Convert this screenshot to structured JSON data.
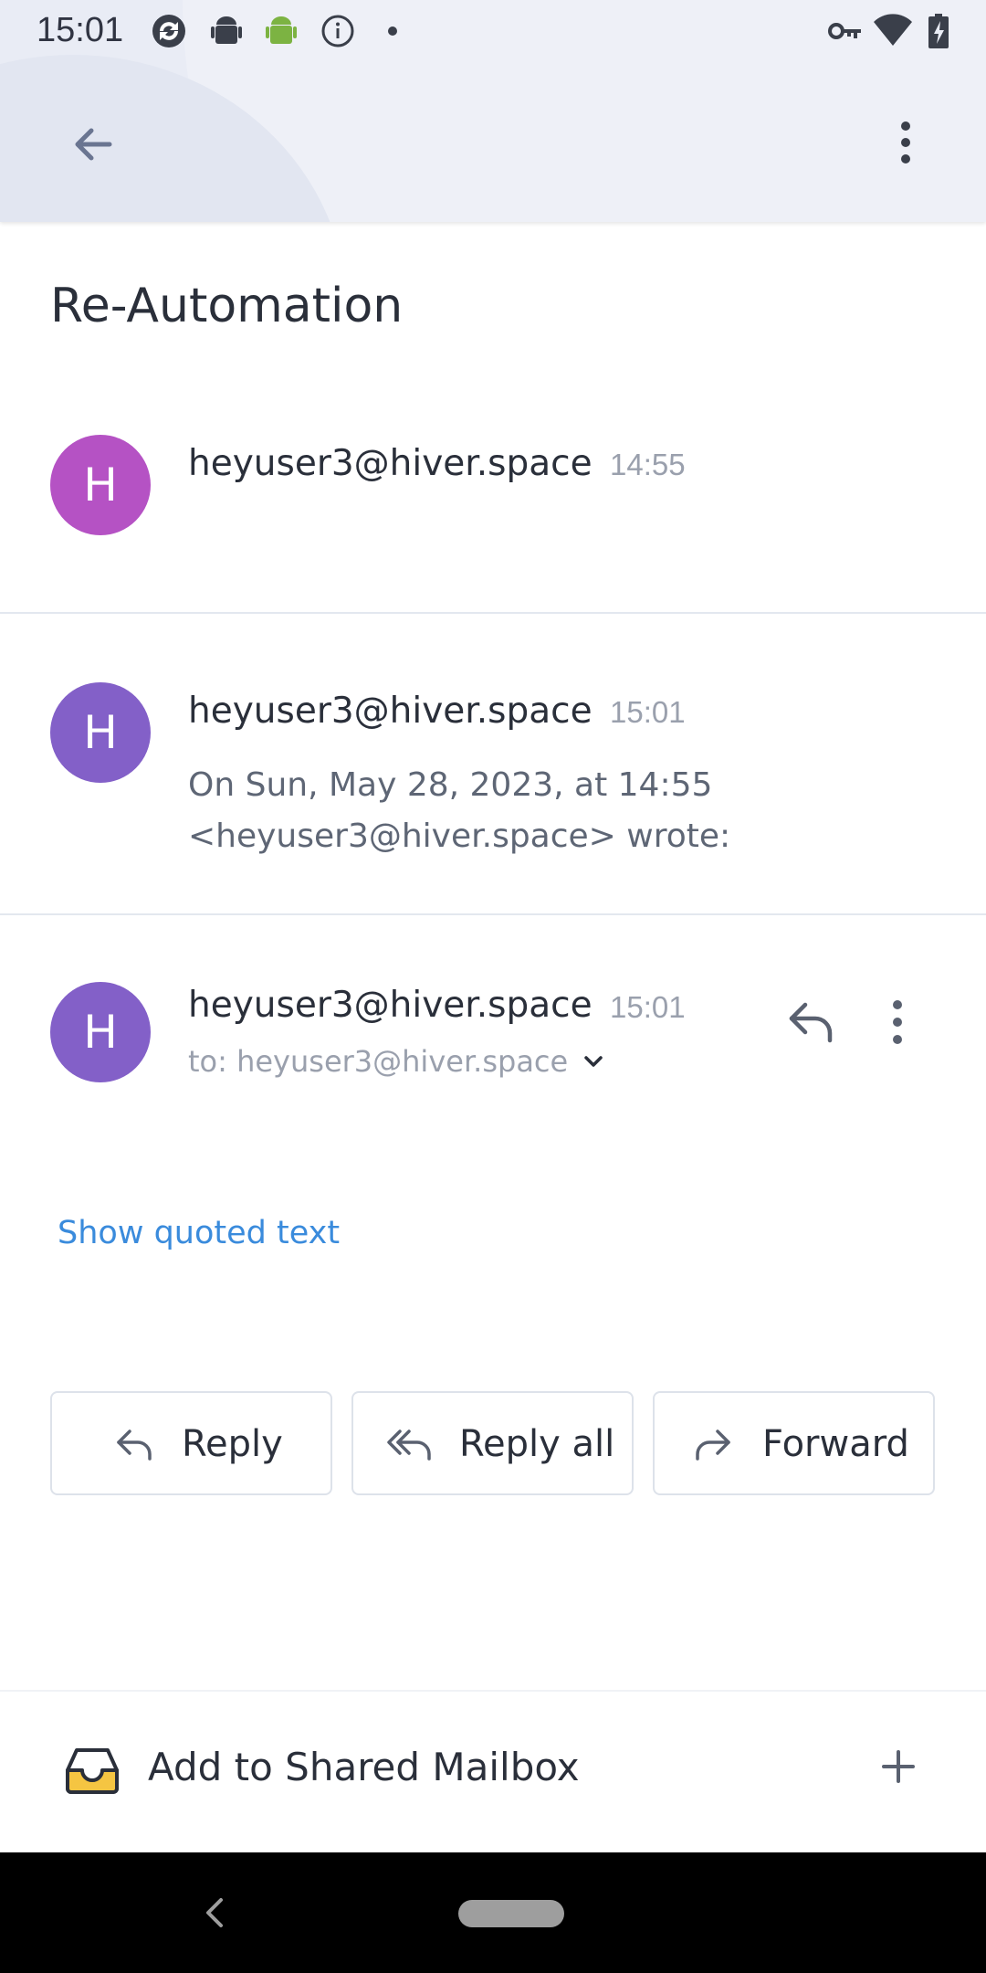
{
  "status_bar": {
    "time": "15:01",
    "left_icons": [
      "sync-icon",
      "android-debug-icon",
      "android-icon",
      "info-icon",
      "dot-icon"
    ],
    "right_icons": [
      "vpn-key-icon",
      "wifi-icon",
      "battery-charging-icon"
    ]
  },
  "app_bar": {
    "back_icon": "arrow-back-icon",
    "more_icon": "more-vertical-icon"
  },
  "thread": {
    "subject": "Re-Automation",
    "messages": [
      {
        "avatar_letter": "H",
        "avatar_color": "#b552c4",
        "sender": "heyuser3@hiver.space",
        "time": "14:55"
      },
      {
        "avatar_letter": "H",
        "avatar_color": "#8360c8",
        "sender": "heyuser3@hiver.space",
        "time": "15:01",
        "snippet_line1": "On Sun, May 28, 2023, at 14:55",
        "snippet_line2": "<heyuser3@hiver.space> wrote:"
      },
      {
        "avatar_letter": "H",
        "avatar_color": "#8360c8",
        "sender": "heyuser3@hiver.space",
        "time": "15:01",
        "to_line": "to: heyuser3@hiver.space",
        "show_quoted_text": "Show quoted text"
      }
    ]
  },
  "actions": {
    "reply": "Reply",
    "reply_all": "Reply all",
    "forward": "Forward"
  },
  "bottom_bar": {
    "label": "Add to Shared Mailbox",
    "icon": "inbox-tray-icon",
    "accent": "#f5c542"
  },
  "colors": {
    "link": "#3a8bdc",
    "header_bg": "#e9ecf5"
  }
}
